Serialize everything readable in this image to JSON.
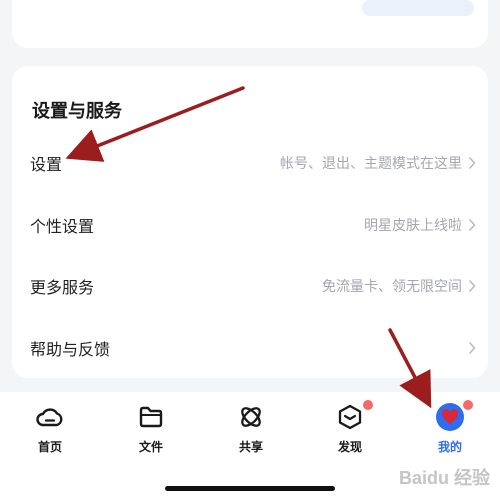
{
  "section": {
    "title": "设置与服务"
  },
  "rows": [
    {
      "label": "设置",
      "hint": "帐号、退出、主题模式在这里"
    },
    {
      "label": "个性设置",
      "hint": "明星皮肤上线啦"
    },
    {
      "label": "更多服务",
      "hint": "免流量卡、领无限空间"
    },
    {
      "label": "帮助与反馈",
      "hint": ""
    }
  ],
  "tabs": [
    {
      "label": "首页",
      "icon": "cloud-icon",
      "badge": false,
      "active": false
    },
    {
      "label": "文件",
      "icon": "folder-icon",
      "badge": false,
      "active": false
    },
    {
      "label": "共享",
      "icon": "share-orbit-icon",
      "badge": false,
      "active": false
    },
    {
      "label": "发现",
      "icon": "discover-box-icon",
      "badge": true,
      "active": false
    },
    {
      "label": "我的",
      "icon": "avatar-icon",
      "badge": true,
      "active": true
    }
  ],
  "watermark": "Baidu 经验",
  "colors": {
    "accent": "#2f6df0",
    "badge": "#f26a6a",
    "arrow": "#9b1d1d",
    "hint": "#a4a7ad",
    "background": "#f4f5f7"
  }
}
